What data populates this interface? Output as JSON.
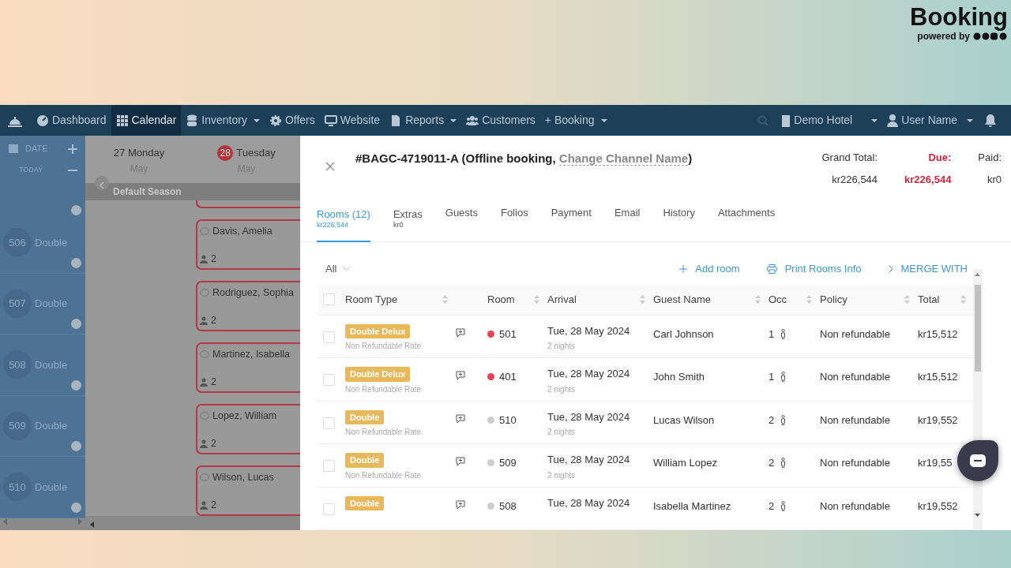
{
  "logo": {
    "title": "Booking",
    "subtitle": "powered by"
  },
  "navbar": {
    "items": [
      {
        "label": "Dashboard",
        "dropdown": false,
        "selected": false
      },
      {
        "label": "Calendar",
        "dropdown": false,
        "selected": true
      },
      {
        "label": "Inventory",
        "dropdown": true,
        "selected": false
      },
      {
        "label": "Offers",
        "dropdown": false,
        "selected": false
      },
      {
        "label": "Website",
        "dropdown": false,
        "selected": false
      },
      {
        "label": "Reports",
        "dropdown": true,
        "selected": false
      },
      {
        "label": "Customers",
        "dropdown": false,
        "selected": false
      },
      {
        "label": "+ Booking",
        "dropdown": true,
        "selected": false
      }
    ],
    "hotel": "Demo Hotel",
    "user": "User Name"
  },
  "calendar": {
    "date_label": "DATE",
    "today_label": "TODAY",
    "days": [
      {
        "label": "27 Monday",
        "month": "May"
      },
      {
        "label": "Tuesday",
        "month": "May",
        "badge": "28"
      }
    ],
    "season": "Default Season",
    "rooms": [
      {
        "number": "506",
        "type": "Double",
        "guest": "Davis, Amelia",
        "occ": "2"
      },
      {
        "number": "507",
        "type": "Double",
        "guest": "Rodriguez, Sophia",
        "occ": "2"
      },
      {
        "number": "508",
        "type": "Double",
        "guest": "Martinez, Isabella",
        "occ": "2"
      },
      {
        "number": "509",
        "type": "Double",
        "guest": "Lopez, William",
        "occ": "2"
      },
      {
        "number": "510",
        "type": "Double",
        "guest": "Wilson, Lucas",
        "occ": "2"
      }
    ]
  },
  "modal": {
    "title": "#BAGC-4719011-A (Offline booking, ",
    "title_link": "Change Channel Name",
    "title_end": ")",
    "totals": [
      {
        "label": "Grand Total:",
        "value": "kr226,544",
        "kind": "normal"
      },
      {
        "label": "Due:",
        "value": "kr226,544",
        "kind": "due"
      },
      {
        "label": "Paid:",
        "value": "kr0",
        "kind": "normal"
      }
    ],
    "tabs": [
      {
        "label": "Rooms (12)",
        "sub": "kr226,544",
        "selected": true
      },
      {
        "label": "Extras",
        "sub": "kr0",
        "selected": false
      },
      {
        "label": "Guests",
        "selected": false
      },
      {
        "label": "Folios",
        "selected": false
      },
      {
        "label": "Payment",
        "selected": false
      },
      {
        "label": "Email",
        "selected": false
      },
      {
        "label": "History",
        "selected": false
      },
      {
        "label": "Attachments",
        "selected": false
      }
    ],
    "filter": "All",
    "actions": [
      {
        "label": "Add room"
      },
      {
        "label": "Print Rooms Info"
      },
      {
        "label": "MERGE WITH"
      }
    ],
    "table": {
      "select_all": false,
      "columns": [
        "Room Type",
        "Room",
        "Arrival",
        "Guest Name",
        "Occ",
        "Policy",
        "Total"
      ],
      "rows": [
        {
          "checked": false,
          "room_type": "Double Delux",
          "rate": "Non Refundable Rate",
          "room": "501",
          "color": "#e04455",
          "arrival": "Tue, 28 May 2024",
          "nights": "2 nights",
          "guest": "Carl Johnson",
          "occ": "1",
          "policy": "Non refundable",
          "total": "kr15,512"
        },
        {
          "checked": false,
          "room_type": "Double Delux",
          "rate": "Non Refundable Rate",
          "room": "401",
          "color": "#e04455",
          "arrival": "Tue, 28 May 2024",
          "nights": "2 nights",
          "guest": "John Smith",
          "occ": "1",
          "policy": "Non refundable",
          "total": "kr15,512"
        },
        {
          "checked": false,
          "room_type": "Double",
          "rate": "Non Refundable Rate",
          "room": "510",
          "color": "#cccccc",
          "arrival": "Tue, 28 May 2024",
          "nights": "2 nights",
          "guest": "Lucas Wilson",
          "occ": "2",
          "policy": "Non refundable",
          "total": "kr19,552"
        },
        {
          "checked": false,
          "room_type": "Double",
          "rate": "Non Refundable Rate",
          "room": "509",
          "color": "#cccccc",
          "arrival": "Tue, 28 May 2024",
          "nights": "2 nights",
          "guest": "William Lopez",
          "occ": "2",
          "policy": "Non refundable",
          "total": "kr19,55"
        },
        {
          "checked": false,
          "room_type": "Double",
          "room": "508",
          "color": "#cccccc",
          "arrival": "Tue, 28 May 2024",
          "guest": "Isabella Martinez",
          "occ": "2",
          "policy": "Non refundable",
          "total": "kr19,552"
        }
      ]
    }
  }
}
